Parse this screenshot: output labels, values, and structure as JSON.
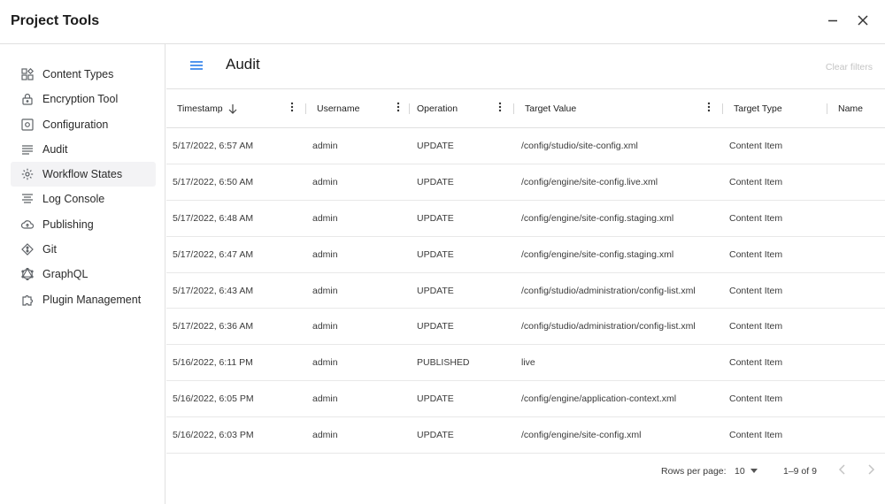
{
  "window": {
    "title": "Project Tools",
    "minimize_icon": "minimize-icon",
    "close_icon": "close-icon"
  },
  "sidebar": {
    "items": [
      {
        "label": "Content Types",
        "icon": "content-types-icon",
        "active": false
      },
      {
        "label": "Encryption Tool",
        "icon": "lock-icon",
        "active": false
      },
      {
        "label": "Configuration",
        "icon": "configuration-icon",
        "active": false
      },
      {
        "label": "Audit",
        "icon": "list-icon",
        "active": false
      },
      {
        "label": "Workflow States",
        "icon": "gear-icon",
        "active": true
      },
      {
        "label": "Log Console",
        "icon": "log-console-icon",
        "active": false
      },
      {
        "label": "Publishing",
        "icon": "cloud-upload-icon",
        "active": false
      },
      {
        "label": "Git",
        "icon": "git-icon",
        "active": false
      },
      {
        "label": "GraphQL",
        "icon": "graphql-icon",
        "active": false
      },
      {
        "label": "Plugin Management",
        "icon": "puzzle-icon",
        "active": false
      }
    ]
  },
  "main": {
    "title": "Audit",
    "clear_filters": "Clear filters",
    "menu_icon": "menu-icon"
  },
  "table": {
    "columns": [
      {
        "label": "Timestamp",
        "sorted": "desc"
      },
      {
        "label": "Username"
      },
      {
        "label": "Operation"
      },
      {
        "label": "Target Value"
      },
      {
        "label": "Target Type"
      },
      {
        "label": "Name"
      }
    ],
    "rows": [
      {
        "timestamp": "5/17/2022, 6:57 AM",
        "username": "admin",
        "operation": "UPDATE",
        "target_value": "/config/studio/site-config.xml",
        "target_type": "Content Item",
        "name": ""
      },
      {
        "timestamp": "5/17/2022, 6:50 AM",
        "username": "admin",
        "operation": "UPDATE",
        "target_value": "/config/engine/site-config.live.xml",
        "target_type": "Content Item",
        "name": ""
      },
      {
        "timestamp": "5/17/2022, 6:48 AM",
        "username": "admin",
        "operation": "UPDATE",
        "target_value": "/config/engine/site-config.staging.xml",
        "target_type": "Content Item",
        "name": ""
      },
      {
        "timestamp": "5/17/2022, 6:47 AM",
        "username": "admin",
        "operation": "UPDATE",
        "target_value": "/config/engine/site-config.staging.xml",
        "target_type": "Content Item",
        "name": ""
      },
      {
        "timestamp": "5/17/2022, 6:43 AM",
        "username": "admin",
        "operation": "UPDATE",
        "target_value": "/config/studio/administration/config-list.xml",
        "target_type": "Content Item",
        "name": ""
      },
      {
        "timestamp": "5/17/2022, 6:36 AM",
        "username": "admin",
        "operation": "UPDATE",
        "target_value": "/config/studio/administration/config-list.xml",
        "target_type": "Content Item",
        "name": ""
      },
      {
        "timestamp": "5/16/2022, 6:11 PM",
        "username": "admin",
        "operation": "PUBLISHED",
        "target_value": "live",
        "target_type": "Content Item",
        "name": ""
      },
      {
        "timestamp": "5/16/2022, 6:05 PM",
        "username": "admin",
        "operation": "UPDATE",
        "target_value": "/config/engine/application-context.xml",
        "target_type": "Content Item",
        "name": ""
      },
      {
        "timestamp": "5/16/2022, 6:03 PM",
        "username": "admin",
        "operation": "UPDATE",
        "target_value": "/config/engine/site-config.xml",
        "target_type": "Content Item",
        "name": ""
      }
    ]
  },
  "pagination": {
    "rows_per_page_label": "Rows per page:",
    "rows_per_page_value": "10",
    "range": "1–9 of 9"
  },
  "colors": {
    "accent": "#1a73e8",
    "icon": "#5f6368",
    "disabled": "#c4c4c4"
  }
}
